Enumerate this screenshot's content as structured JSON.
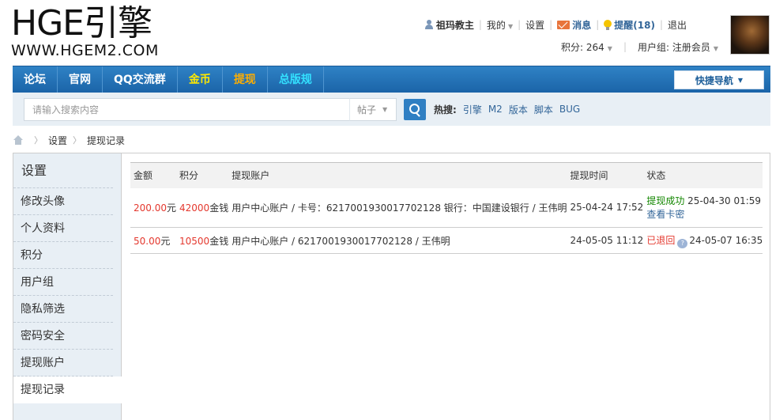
{
  "logo": {
    "brand": "HGE引擎",
    "url": "WWW.HGEM2.COM"
  },
  "user": {
    "name": "祖玛教主",
    "my": "我的",
    "settings": "设置",
    "messages": "消息",
    "reminders": "提醒(18)",
    "logout": "退出",
    "points": "积分: 264",
    "group": "用户组: 注册会员"
  },
  "nav": {
    "items": [
      {
        "label": "论坛",
        "color": "#ffffff"
      },
      {
        "label": "官网",
        "color": "#ffffff"
      },
      {
        "label": "QQ交流群",
        "color": "#ffffff"
      },
      {
        "label": "金币",
        "color": "#ffe900"
      },
      {
        "label": "提现",
        "color": "#ffae00"
      },
      {
        "label": "总版规",
        "color": "#33e0ff"
      }
    ],
    "quick_nav": "快捷导航"
  },
  "search": {
    "placeholder": "请输入搜索内容",
    "type": "帖子",
    "hot_label": "热搜:",
    "hot_links": [
      "引擎",
      "M2",
      "版本",
      "脚本",
      "BUG"
    ]
  },
  "breadcrumb": {
    "items": [
      "设置",
      "提现记录"
    ]
  },
  "sidebar": {
    "title": "设置",
    "items": [
      "修改头像",
      "个人资料",
      "积分",
      "用户组",
      "隐私筛选",
      "密码安全",
      "提现账户",
      "提现记录"
    ],
    "active": "提现记录"
  },
  "table": {
    "headers": [
      "金额",
      "积分",
      "提现账户",
      "提现时间",
      "状态"
    ],
    "rows": [
      {
        "amount": "200.00",
        "amount_unit": "元",
        "points": "42000",
        "points_unit": "金钱",
        "account": "用户中心账户 / 卡号：6217001930017702128 银行：中国建设银行 / 王伟明",
        "time": "25-04-24 17:52",
        "status": "提现成功",
        "status_time": "25-04-30 01:59",
        "status_link": "查看卡密"
      },
      {
        "amount": "50.00",
        "amount_unit": "元",
        "points": "10500",
        "points_unit": "金钱",
        "account": "用户中心账户 / 6217001930017702128 / 王伟明",
        "time": "24-05-05 11:12",
        "status": "已退回",
        "status_time": "24-05-07 16:35"
      }
    ]
  },
  "colors": {
    "nav_bg": "#1f6db3",
    "accent_blue": "#336699",
    "money_red": "#e4382e",
    "success_green": "#138700",
    "sidebar_bg": "#e8eff5"
  }
}
